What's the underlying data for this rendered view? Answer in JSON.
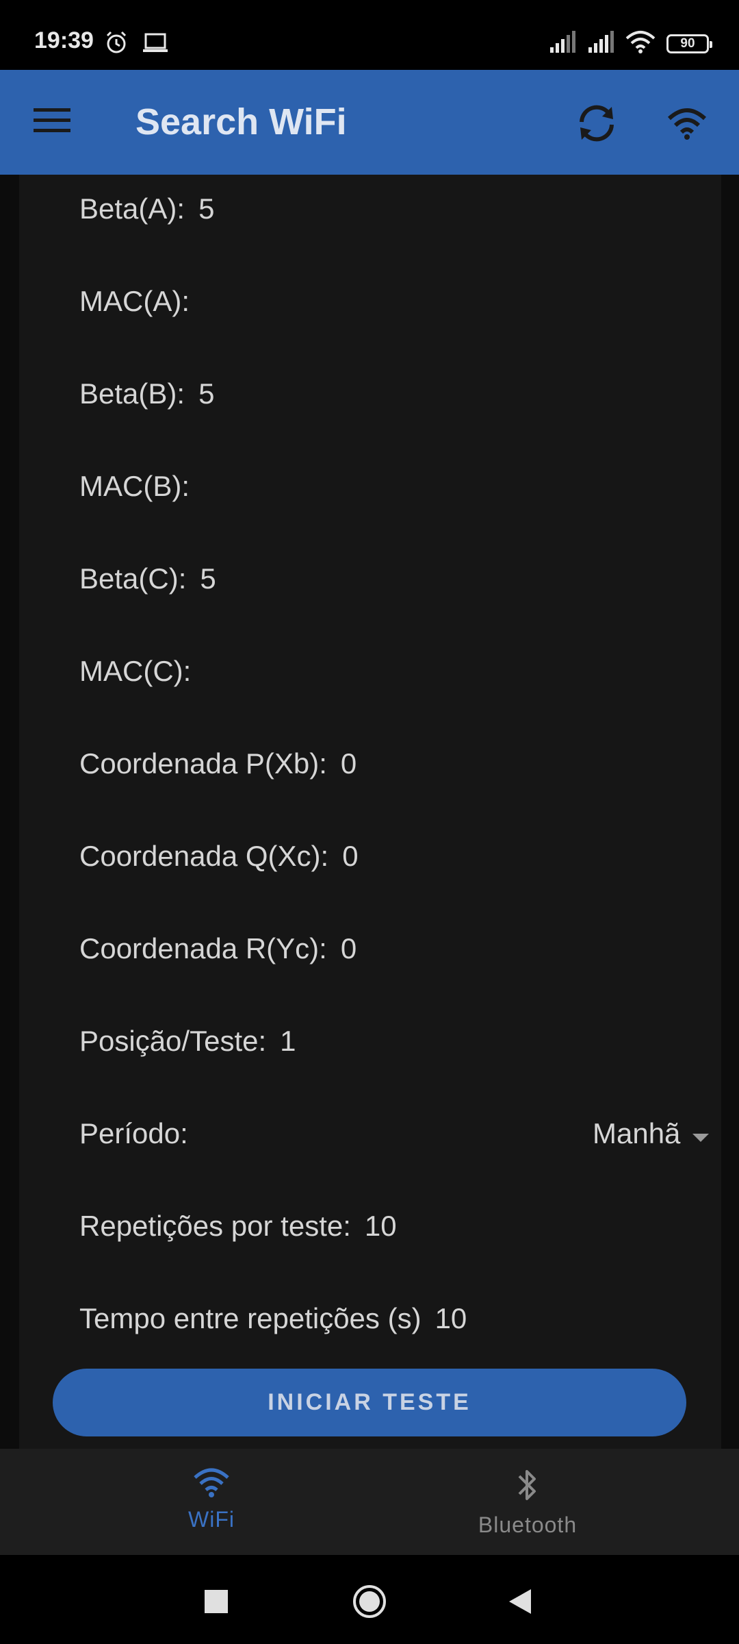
{
  "status_bar": {
    "time": "19:39",
    "battery": "90"
  },
  "app_bar": {
    "title": "Search WiFi"
  },
  "fields": [
    {
      "label": "Beta(A):",
      "value": "5"
    },
    {
      "label": "MAC(A):",
      "value": ""
    },
    {
      "label": "Beta(B):",
      "value": "5"
    },
    {
      "label": "MAC(B):",
      "value": ""
    },
    {
      "label": "Beta(C):",
      "value": "5"
    },
    {
      "label": "MAC(C):",
      "value": ""
    },
    {
      "label": "Coordenada P(Xb):",
      "value": "0"
    },
    {
      "label": "Coordenada Q(Xc):",
      "value": "0"
    },
    {
      "label": "Coordenada R(Yc):",
      "value": "0"
    },
    {
      "label": "Posição/Teste:",
      "value": "1"
    },
    {
      "label": "Período:",
      "value": ""
    },
    {
      "label": "Repetições por teste:",
      "value": "10"
    },
    {
      "label": "Tempo entre repetições (s)",
      "value": "10"
    }
  ],
  "periodo_select": {
    "selected": "Manhã"
  },
  "start_button": {
    "label": "INICIAR TESTE"
  },
  "bottom_nav": {
    "items": [
      {
        "label": "WiFi",
        "icon": "wifi-icon",
        "active": true
      },
      {
        "label": "Bluetooth",
        "icon": "bluetooth-icon",
        "active": false
      }
    ]
  },
  "colors": {
    "primary": "#2d62ae",
    "active_tab": "#3a72c4",
    "inactive_tab": "#8a8a8a",
    "card_background": "#161616"
  }
}
